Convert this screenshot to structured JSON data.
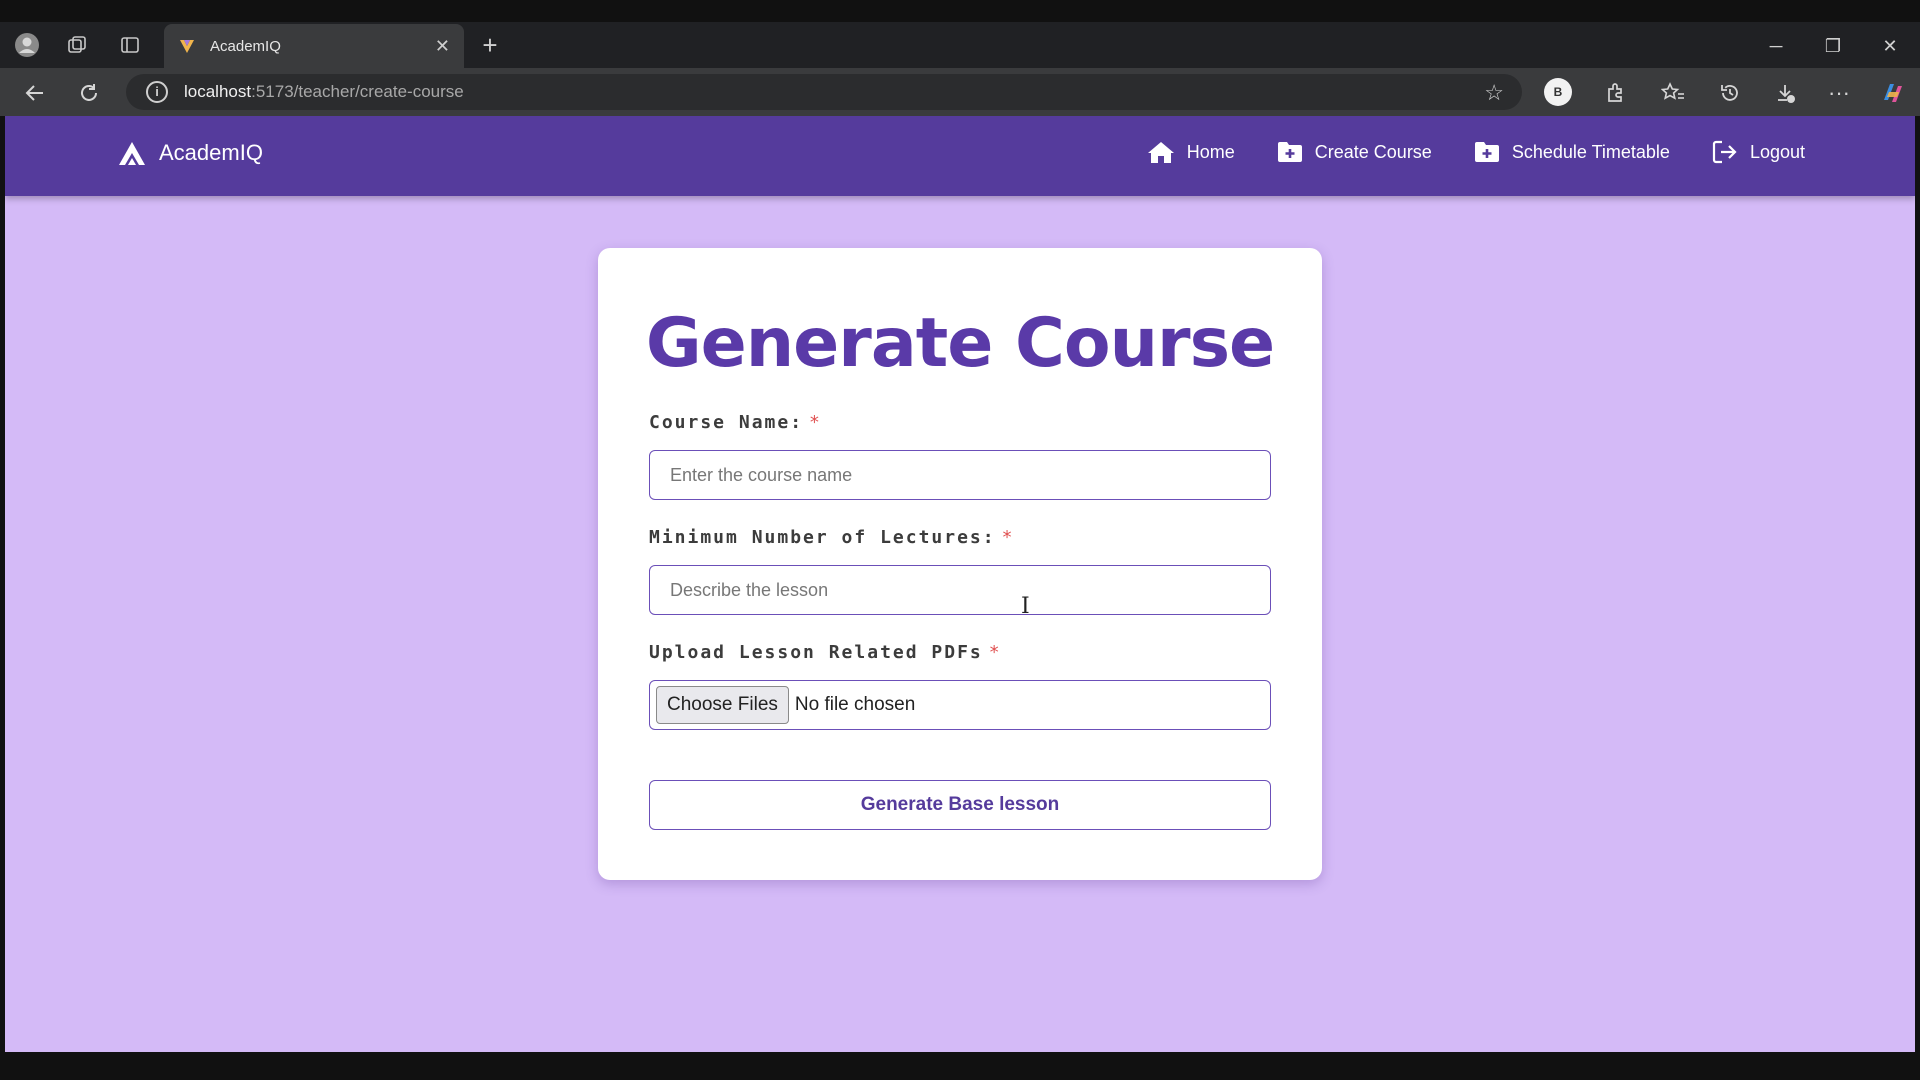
{
  "browser": {
    "tab_title": "AcademIQ",
    "url_host": "localhost",
    "url_path": ":5173/teacher/create-course",
    "profile_initial": "B"
  },
  "app": {
    "brand": "AcademIQ",
    "nav": [
      {
        "label": "Home",
        "icon": "home-icon"
      },
      {
        "label": "Create Course",
        "icon": "folder-plus-icon"
      },
      {
        "label": "Schedule Timetable",
        "icon": "folder-plus-icon"
      },
      {
        "label": "Logout",
        "icon": "logout-icon"
      }
    ]
  },
  "form": {
    "title": "Generate Course",
    "course_name_label": "Course Name:",
    "course_name_placeholder": "Enter the course name",
    "lectures_label": "Minimum Number of Lectures:",
    "lectures_placeholder": "Describe the lesson",
    "upload_label": "Upload Lesson Related PDFs",
    "file_button": "Choose Files",
    "file_status": "No file chosen",
    "required_mark": "*",
    "submit_label": "Generate Base lesson"
  },
  "colors": {
    "nav_bg": "#553b9c",
    "page_bg": "#d4baf7",
    "accent": "#5a3aa8"
  }
}
